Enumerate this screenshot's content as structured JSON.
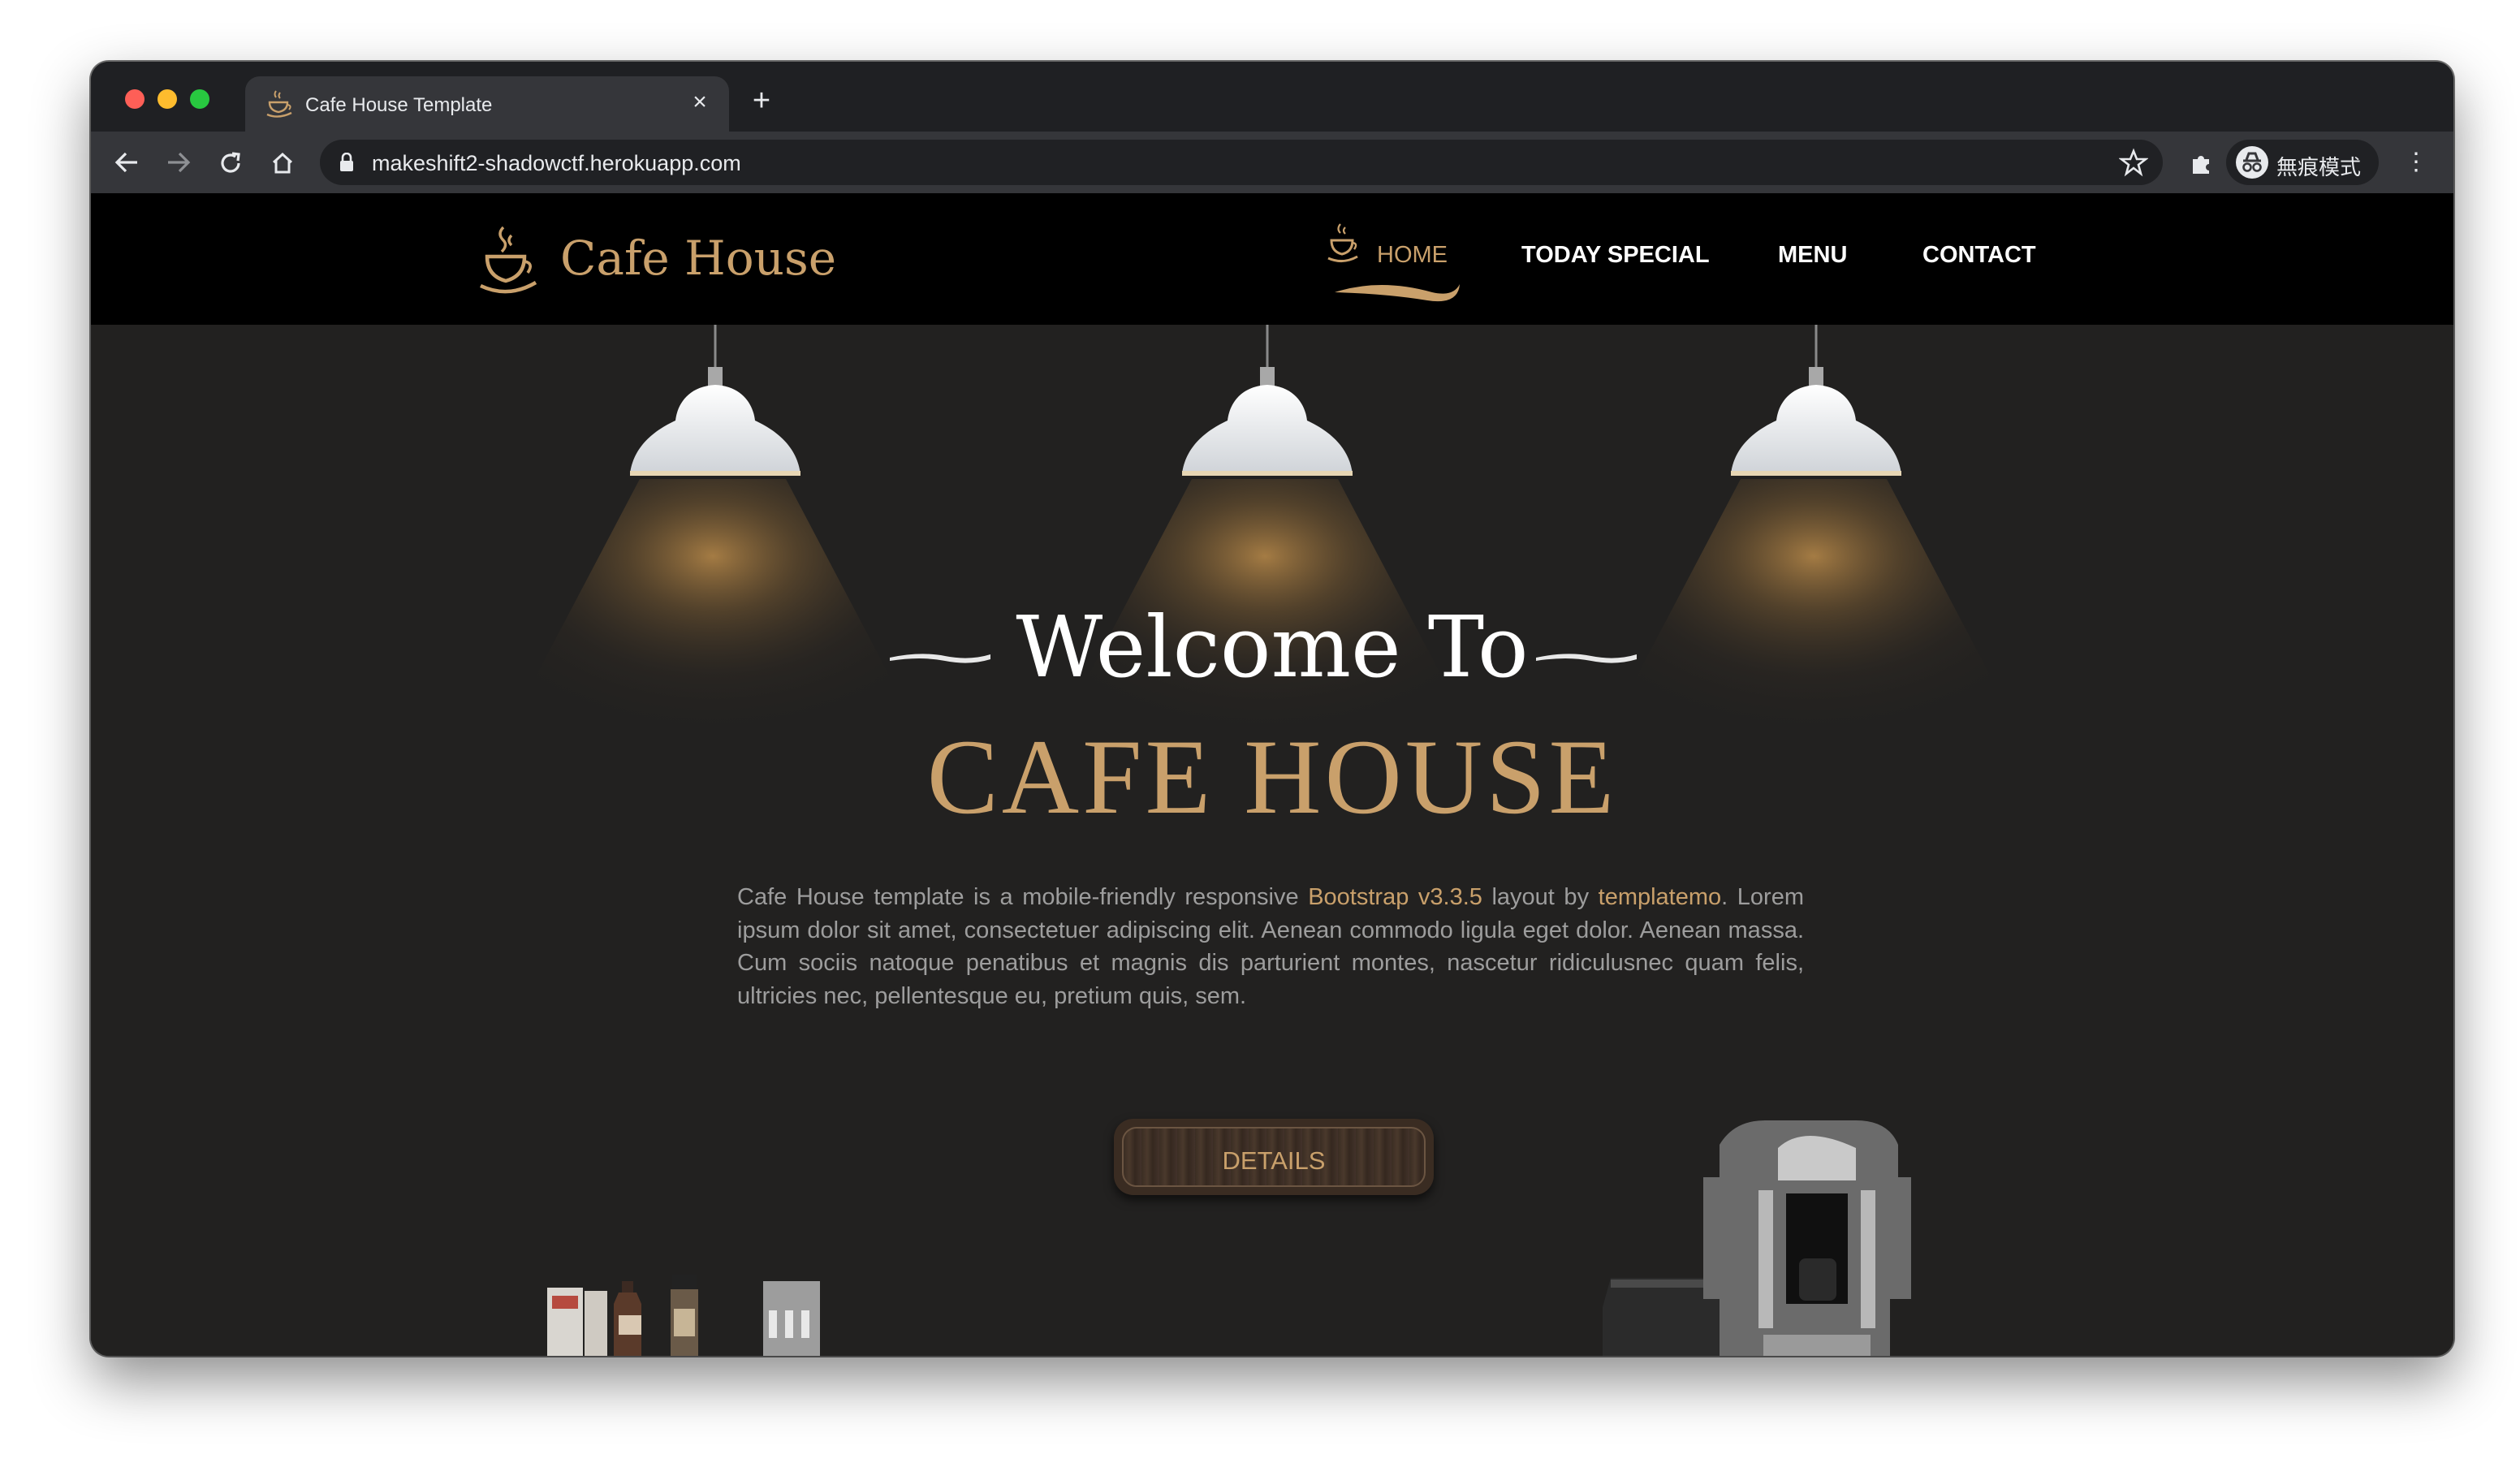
{
  "browser": {
    "tab_title": "Cafe House Template",
    "tab_close": "×",
    "new_tab": "+",
    "url": "makeshift2-shadowctf.herokuapp.com",
    "profile_label": "無痕模式",
    "menu_glyph": "⋮"
  },
  "site": {
    "logo_text": "Cafe House",
    "nav": {
      "home": "HOME",
      "today_special": "TODAY SPECIAL",
      "menu": "MENU",
      "contact": "CONTACT"
    }
  },
  "hero": {
    "welcome": "Welcome To",
    "title": "CAFE HOUSE",
    "description": {
      "part1": "Cafe House template is a mobile-friendly responsive ",
      "link1": "Bootstrap v3.3.5",
      "part2": " layout by ",
      "link2": "templatemo",
      "part3": ". Lorem ipsum dolor sit amet, consectetuer adipiscing elit. Aenean commodo ligula eget dolor. Aenean massa. Cum sociis natoque penatibus et magnis dis parturient montes, nascetur ridiculusnec quam felis, ultricies nec, pellentesque eu, pretium quis, sem."
    },
    "button": "DETAILS"
  },
  "colors": {
    "accent": "#c9a06b",
    "header_bg": "#000000",
    "hero_bg": "#222120",
    "text_muted": "#9d9d9d"
  }
}
